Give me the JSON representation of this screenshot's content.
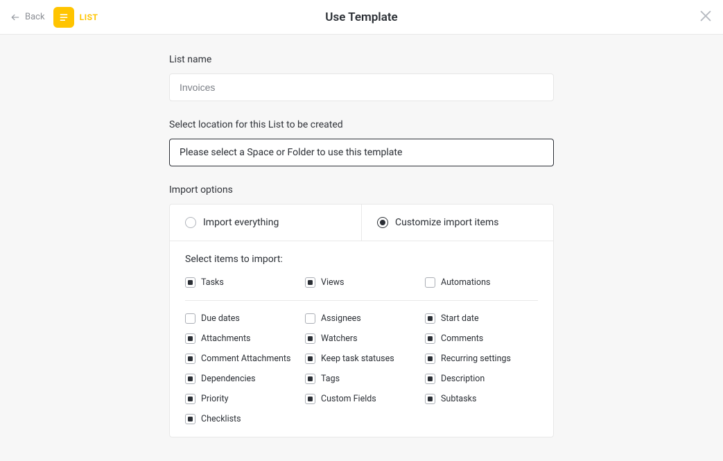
{
  "header": {
    "back_label": "Back",
    "list_label": "LIST",
    "title": "Use Template"
  },
  "form": {
    "list_name_label": "List name",
    "list_name_value": "Invoices",
    "location_label": "Select location for this List to be created",
    "location_placeholder": "Please select a Space or Folder to use this template",
    "import_options_label": "Import options",
    "radio_everything": "Import everything",
    "radio_customize": "Customize import items",
    "select_items_label": "Select items to import:"
  },
  "checkboxes": {
    "top": [
      {
        "key": "tasks",
        "label": "Tasks",
        "checked": true
      },
      {
        "key": "views",
        "label": "Views",
        "checked": true
      },
      {
        "key": "automations",
        "label": "Automations",
        "checked": false
      }
    ],
    "rest": [
      {
        "key": "due_dates",
        "label": "Due dates",
        "checked": false
      },
      {
        "key": "assignees",
        "label": "Assignees",
        "checked": false
      },
      {
        "key": "start_date",
        "label": "Start date",
        "checked": true
      },
      {
        "key": "attachments",
        "label": "Attachments",
        "checked": true
      },
      {
        "key": "watchers",
        "label": "Watchers",
        "checked": true
      },
      {
        "key": "comments",
        "label": "Comments",
        "checked": true
      },
      {
        "key": "comment_attachments",
        "label": "Comment Attachments",
        "checked": true
      },
      {
        "key": "keep_task_statuses",
        "label": "Keep task statuses",
        "checked": true
      },
      {
        "key": "recurring_settings",
        "label": "Recurring settings",
        "checked": true
      },
      {
        "key": "dependencies",
        "label": "Dependencies",
        "checked": true
      },
      {
        "key": "tags",
        "label": "Tags",
        "checked": true
      },
      {
        "key": "description",
        "label": "Description",
        "checked": true
      },
      {
        "key": "priority",
        "label": "Priority",
        "checked": true
      },
      {
        "key": "custom_fields",
        "label": "Custom Fields",
        "checked": true
      },
      {
        "key": "subtasks",
        "label": "Subtasks",
        "checked": true
      },
      {
        "key": "checklists",
        "label": "Checklists",
        "checked": true
      }
    ]
  }
}
